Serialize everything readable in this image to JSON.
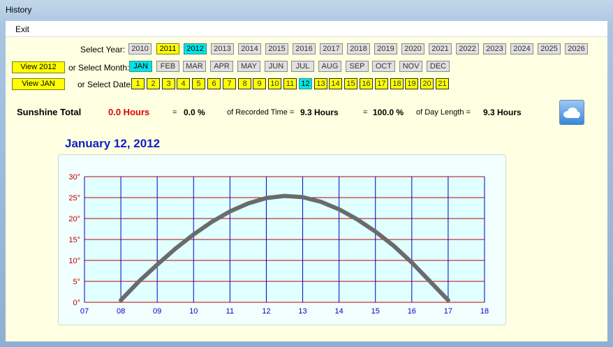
{
  "window": {
    "title": "History"
  },
  "menu": {
    "exit": "Exit"
  },
  "labels": {
    "select_year": "Select Year:",
    "select_month": "or Select Month:",
    "select_date": "or Select Date:",
    "view_year": "View 2012",
    "view_month": "View JAN"
  },
  "years": [
    "2010",
    "2011",
    "2012",
    "2013",
    "2014",
    "2015",
    "2016",
    "2017",
    "2018",
    "2019",
    "2020",
    "2021",
    "2022",
    "2023",
    "2024",
    "2025",
    "2026"
  ],
  "months": [
    "JAN",
    "FEB",
    "MAR",
    "APR",
    "MAY",
    "JUN",
    "JUL",
    "AUG",
    "SEP",
    "OCT",
    "NOV",
    "DEC"
  ],
  "dates": [
    "1",
    "2",
    "3",
    "4",
    "5",
    "6",
    "7",
    "8",
    "9",
    "10",
    "11",
    "12",
    "13",
    "14",
    "15",
    "16",
    "17",
    "18",
    "19",
    "20",
    "21"
  ],
  "selected": {
    "year": "2012",
    "month": "JAN",
    "date": "12"
  },
  "summary": {
    "label": "Sunshine Total",
    "hours": "0.0 Hours",
    "eq1": "=",
    "pct1": "0.0 %",
    "recorded_label": "of Recorded Time =",
    "recorded": "9.3 Hours",
    "eq2": "=",
    "pct2": "100.0 %",
    "daylen_label": "of Day Length =",
    "daylen": "9.3 Hours"
  },
  "icons": {
    "weather": "cloud-icon"
  },
  "colors": {
    "background": "#ffffe1",
    "plot_bg": "#e0ffff",
    "h_grid": "#c00000",
    "v_grid": "#0000c0",
    "curve": "#6b6b6b",
    "y_label": "#c00000",
    "x_label": "#0000c0",
    "heading": "#1020c8"
  },
  "chart_title": "January 12, 2012",
  "chart_data": {
    "type": "line",
    "title": "January 12, 2012",
    "xlabel": "",
    "ylabel": "",
    "x_ticks": [
      "07",
      "08",
      "09",
      "10",
      "11",
      "12",
      "13",
      "14",
      "15",
      "16",
      "17",
      "18"
    ],
    "y_ticks": [
      "0°",
      "5°",
      "10°",
      "15°",
      "20°",
      "25°",
      "30°"
    ],
    "xlim": [
      7,
      18
    ],
    "ylim": [
      0,
      30
    ],
    "grid": true,
    "series": [
      {
        "x": [
          8.0,
          8.5,
          9.0,
          9.5,
          10.0,
          10.5,
          11.0,
          11.5,
          12.0,
          12.5,
          13.0,
          13.5,
          14.0,
          14.5,
          15.0,
          15.5,
          16.0,
          16.5,
          17.0
        ],
        "y": [
          0.5,
          5.0,
          9.0,
          12.8,
          16.2,
          19.2,
          21.7,
          23.6,
          24.9,
          25.4,
          25.1,
          24.0,
          22.2,
          19.8,
          16.9,
          13.5,
          9.5,
          5.0,
          0.5
        ]
      }
    ]
  }
}
